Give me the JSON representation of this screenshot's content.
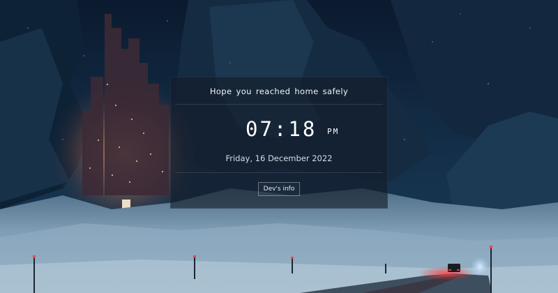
{
  "greeting": "Hope you reached home safely",
  "clock": {
    "time": "07:18",
    "period": "PM"
  },
  "date": "Friday, 16 December 2022",
  "buttons": {
    "dev_info": "Dev's info"
  },
  "colors": {
    "sky": "#0d2038",
    "snow": "#9ab3c8",
    "city_glow": "#e39a62",
    "car_light": "#ff3a3a"
  }
}
